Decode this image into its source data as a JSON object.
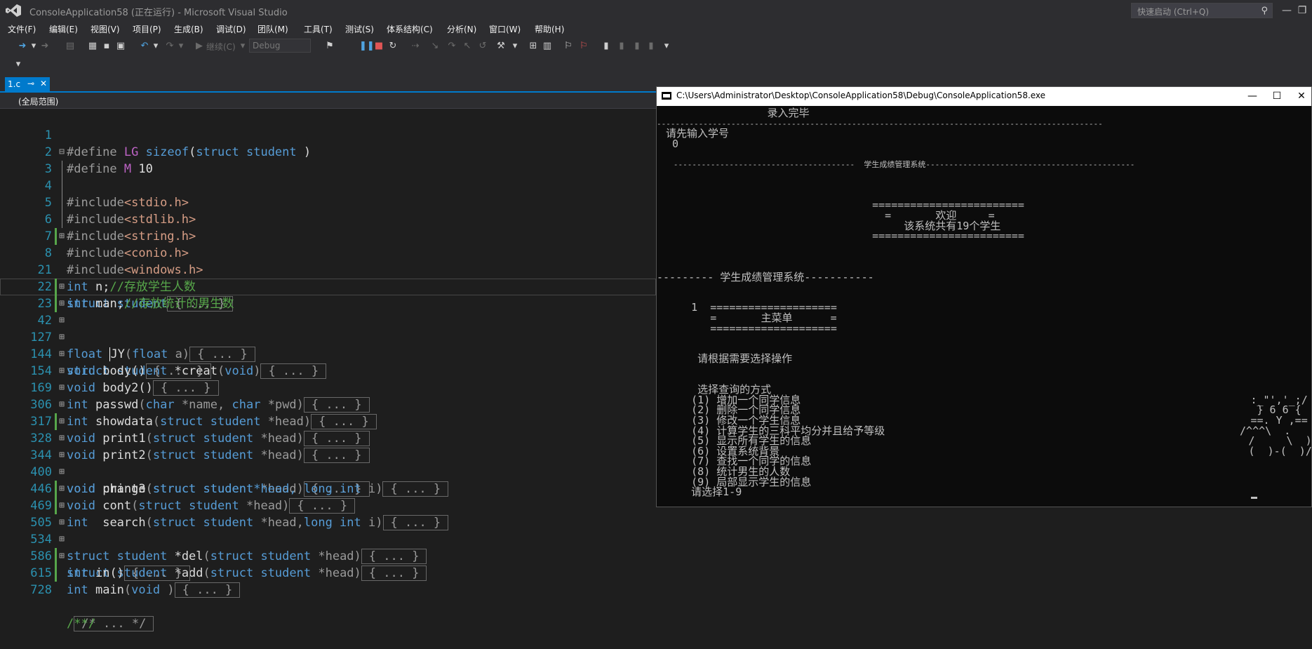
{
  "window": {
    "title": "ConsoleApplication58 (正在运行) - Microsoft Visual Studio",
    "quick_launch_placeholder": "快速启动 (Ctrl+Q)",
    "minimize": "—",
    "restore": "❐",
    "close": "✕"
  },
  "menu": {
    "items": [
      "文件(F)",
      "编辑(E)",
      "视图(V)",
      "项目(P)",
      "生成(B)",
      "调试(D)",
      "团队(M)",
      "工具(T)",
      "测试(S)",
      "体系结构(C)",
      "分析(N)",
      "窗口(W)",
      "帮助(H)"
    ]
  },
  "toolbar": {
    "continue_label": "继续(C)",
    "config_value": "Debug"
  },
  "tab": {
    "name": "1.c",
    "pin": "⊸",
    "close": "✕"
  },
  "navbar": {
    "scope": "(全局范围)"
  },
  "code": {
    "l1": {
      "n": "1",
      "d": "#define",
      "m": "LG",
      "a": "sizeof",
      "b": "(",
      "c": "struct",
      "e": "student",
      "f": ")"
    },
    "l2": {
      "n": "2",
      "d": "#define",
      "m": "M",
      "v": "10"
    },
    "l3": {
      "n": "3",
      "d": "#include",
      "h": "<stdio.h>"
    },
    "l4": {
      "n": "4",
      "d": "#include",
      "h": "<stdlib.h>"
    },
    "l5": {
      "n": "5",
      "d": "#include",
      "h": "<string.h>"
    },
    "l6": {
      "n": "6",
      "d": "#include",
      "h": "<conio.h>"
    },
    "l7": {
      "n": "7",
      "d": "#include",
      "h": "<windows.h>"
    },
    "l8": {
      "n": "8",
      "k1": "struct",
      "k2": "student",
      "col": "{ ... }"
    },
    "l21": {
      "n": "21",
      "k": "int",
      "v": "n;",
      "c": "//存放学生人数"
    },
    "l22": {
      "n": "22",
      "k": "int",
      "v": "man;",
      "c": "//存放统计的男生数"
    },
    "l23": {
      "n": "23",
      "k": "float",
      "f": "JY",
      "p1": "(",
      "k2": "float",
      "p2": "a)",
      "col": "{ ... }"
    },
    "l42": {
      "n": "42",
      "k": "struct",
      "t": "student",
      "f": "*creat",
      "p1": "(",
      "k2": "void",
      "p2": ")",
      "col": "{ ... }"
    },
    "l127": {
      "n": "127",
      "k": "void",
      "f": "body()",
      "col": "{ ... }"
    },
    "l144": {
      "n": "144",
      "k": "void",
      "f": "body2()",
      "col": "{ ... }"
    },
    "l154": {
      "n": "154",
      "k": "int",
      "f": "passwd",
      "p1": "(",
      "k2": "char",
      "p2": "*name,",
      "k3": "char",
      "p3": "*pwd)",
      "col": "{ ... }"
    },
    "l169": {
      "n": "169",
      "k": "int",
      "f": "showdata",
      "p1": "(",
      "k2": "struct",
      "t": "student",
      "p2": "*head)",
      "col": "{ ... }"
    },
    "l306": {
      "n": "306",
      "k": "void",
      "f": "print1",
      "p1": "(",
      "k2": "struct",
      "t": "student",
      "p2": "*head)",
      "col": "{ ... }"
    },
    "l317": {
      "n": "317",
      "k": "void",
      "f": "print2",
      "p1": "(",
      "k2": "struct",
      "t": "student",
      "p2": "*head)",
      "col": "{ ... }"
    },
    "l328": {
      "n": "328",
      "k": "void",
      "f": "print3",
      "p1": "(",
      "k2": "struct",
      "t": "student",
      "p2": "*head)",
      "col": "{ ... }"
    },
    "l344": {
      "n": "344",
      "k": "void",
      "f": "change",
      "p1": "(",
      "k2": "struct",
      "t": "student*head,",
      "k3": "long int",
      "p2": "i)",
      "col": "{ ... }"
    },
    "l400": {
      "n": "400",
      "k": "void",
      "f": "cont",
      "p1": "(",
      "k2": "struct",
      "t": "student",
      "p2": "*head)",
      "col": "{ ... }"
    },
    "l446": {
      "n": "446",
      "k": "int",
      "f": "search",
      "p1": "(",
      "k2": "struct",
      "t": "student",
      "p2": "*head,",
      "k3": "long int",
      "p3": "i)",
      "col": "{ ... }"
    },
    "l469": {
      "n": "469",
      "k": "struct",
      "t": "student",
      "f": "*del",
      "p1": "(",
      "k2": "struct",
      "t2": "student",
      "p2": "*head)",
      "col": "{ ... }"
    },
    "l505": {
      "n": "505",
      "k": "struct",
      "t": "student",
      "f": "*add",
      "p1": "(",
      "k2": "struct",
      "t2": "student",
      "p2": "*head)",
      "col": "{ ... }"
    },
    "l534": {
      "n": "534",
      "k": "int",
      "f": "in()",
      "col": "{ ... }"
    },
    "l586": {
      "n": "586",
      "k": "int",
      "f": "main",
      "p1": "(",
      "k2": "void",
      "p2": ")",
      "col": "{ ... }"
    },
    "l615": {
      "n": "615",
      "col": "/* ... */"
    },
    "l728": {
      "n": "728",
      "c": "/**/"
    }
  },
  "console": {
    "path": "C:\\Users\\Administrator\\Desktop\\ConsoleApplication58\\Debug\\ConsoleApplication58.exe",
    "minimize": "—",
    "maximize": "☐",
    "close": "✕",
    "lines": [
      "                 录入完毕",
      "------------------------------------------------------------------------------------------------",
      " 请先输入学号",
      "  0",
      "",
      "   ---------------------------------------  学生成绩管理系统---------------------------------------------",
      "",
      "",
      "",
      "                                    ========================",
      "                                      =       欢迎     =",
      "                                         该系统共有19个学生",
      "                                    ========================",
      "",
      "",
      "",
      "--------- 学生成绩管理系统-----------",
      "",
      "",
      "     1  ====================",
      "        =       主菜单      =",
      "        ====================",
      "",
      "",
      "      请根据需要选择操作",
      "",
      "",
      "      选择查询的方式",
      "     (1) 增加一个同学信息                                                                       :_\"','_;/",
      "     (2) 删除一个同学信息                                                                        } 6 6 {",
      "     (3) 修改一个学生信息                                                                       ==. Y ,==",
      "     (4) 计算学生的三科平均分并且给予等级                                                        /^^^\\  .",
      "     (5) 显示所有学生的信息                                                                     /     \\  )",
      "     (6) 设置系统背景                                                                          (  )-(  )/  _",
      "     (7) 查找一个同学的信息",
      "     (8) 统计男生的人数",
      "     (9) 局部显示学生的信息",
      "     请选择1-9"
    ]
  }
}
